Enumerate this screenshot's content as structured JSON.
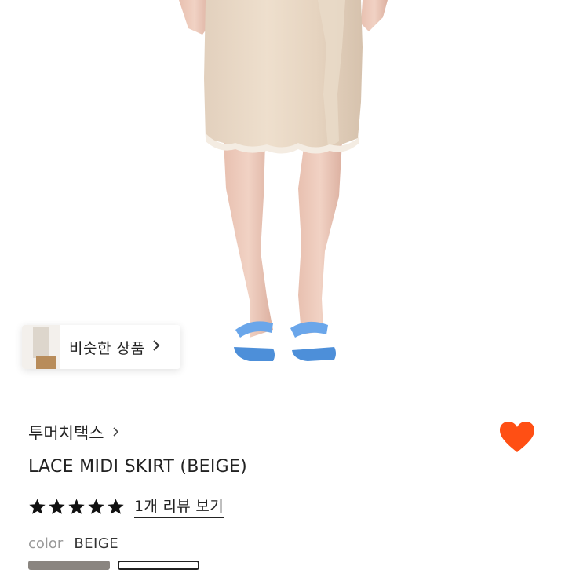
{
  "similar": {
    "label": "비슷한 상품"
  },
  "product": {
    "brand": "투머치택스",
    "title": "LACE MIDI SKIRT (BEIGE)",
    "rating_stars": 5,
    "review_link": "1개 리뷰 보기",
    "color_label": "color",
    "color_value": "BEIGE"
  },
  "colors": {
    "accent": "#FF4F14",
    "text": "#222222",
    "muted": "#999999"
  },
  "icons": [
    "chevron-right-icon",
    "heart-icon",
    "star-icon"
  ]
}
